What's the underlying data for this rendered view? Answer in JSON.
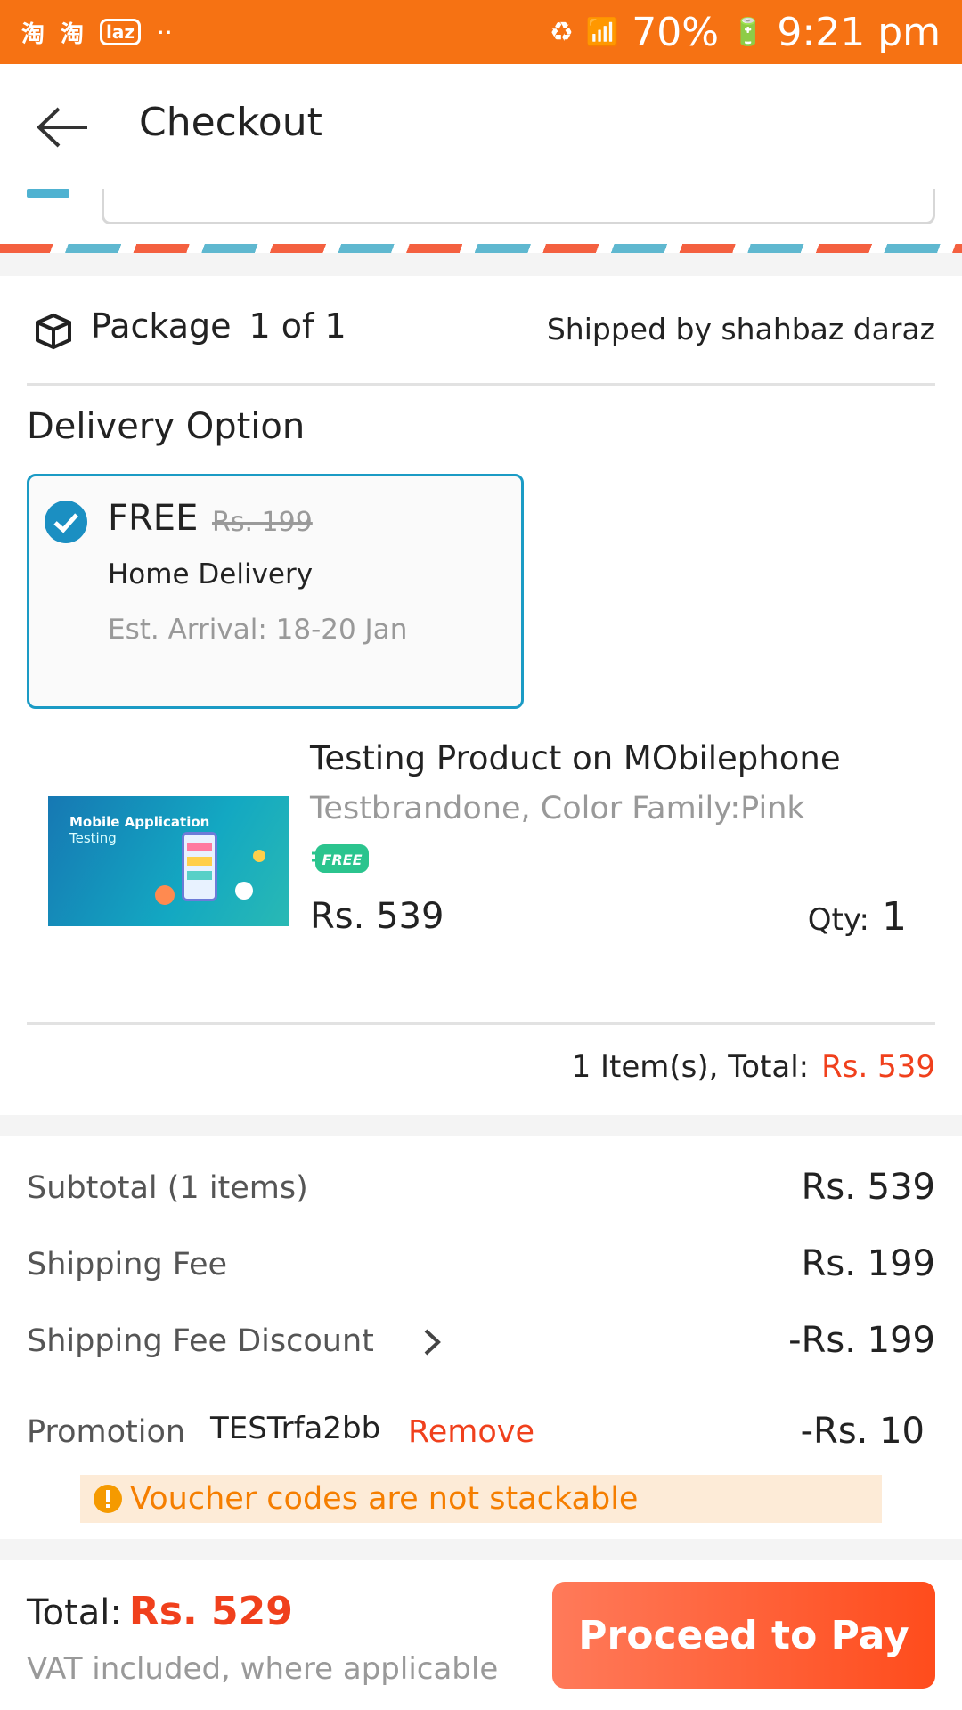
{
  "status_bar": {
    "app_icons": [
      "淘",
      "淘",
      "laz",
      "··"
    ],
    "battery": "70%",
    "time": "9:21 pm"
  },
  "header": {
    "title": "Checkout"
  },
  "package": {
    "label": "Package",
    "count": "1 of 1",
    "shipped_by": "Shipped by shahbaz daraz"
  },
  "delivery": {
    "heading": "Delivery Option",
    "price": "FREE",
    "old_price": "Rs. 199",
    "type": "Home Delivery",
    "eta": "Est. Arrival: 18-20 Jan"
  },
  "product": {
    "image_title": "Mobile Application",
    "image_subtitle": "Testing",
    "name": "Testing Product on MObilephone",
    "variant": "Testbrandone, Color Family:Pink",
    "badge": "FREE",
    "price": "Rs. 539",
    "qty_label": "Qty:",
    "qty": "1"
  },
  "items_total": {
    "label": "1 Item(s), Total:",
    "amount": "Rs. 539"
  },
  "summary": {
    "subtotal_label": "Subtotal (1 items)",
    "subtotal_value": "Rs. 539",
    "shipping_label": "Shipping Fee",
    "shipping_value": "Rs. 199",
    "discount_label": "Shipping Fee Discount",
    "discount_value": "-Rs. 199",
    "promotion_label": "Promotion",
    "promotion_code": "TESTrfa2bb",
    "remove_label": "Remove",
    "promotion_value": "-Rs. 10",
    "warning": "Voucher codes are not stackable"
  },
  "footer": {
    "total_label": "Total:",
    "total_amount": "Rs. 529",
    "vat_note": "VAT included, where applicable",
    "pay_button": "Proceed to Pay"
  },
  "colors": {
    "status_bar": "#f67213",
    "accent_red": "#f0401c",
    "selected_border": "#1b9bc5",
    "warning_bg": "#fdebd7",
    "warning_text": "#f57e00"
  }
}
